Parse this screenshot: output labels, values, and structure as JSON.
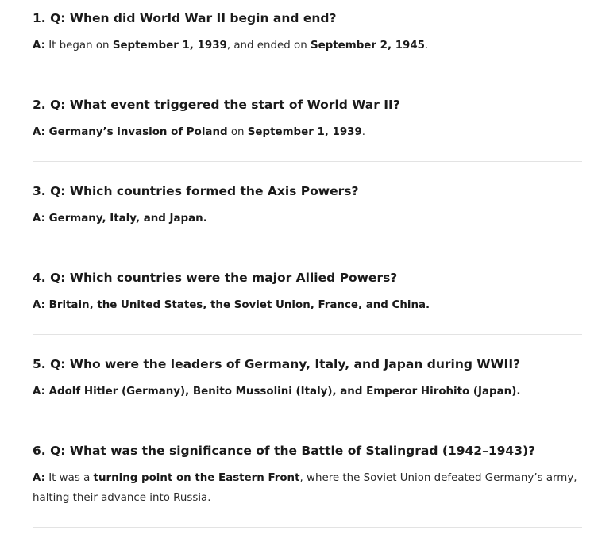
{
  "faq": [
    {
      "question": "1. Q: When did World War II begin and end?",
      "answer_label": "A:",
      "answer_parts": [
        {
          "text": " It began on ",
          "bold": false
        },
        {
          "text": "September 1, 1939",
          "bold": true
        },
        {
          "text": ", and ended on ",
          "bold": false
        },
        {
          "text": "September 2, 1945",
          "bold": true
        },
        {
          "text": ".",
          "bold": false
        }
      ]
    },
    {
      "question": "2. Q: What event triggered the start of World War II?",
      "answer_label": "A:",
      "answer_parts": [
        {
          "text": " Germany’s invasion of Poland",
          "bold": true
        },
        {
          "text": " on ",
          "bold": false
        },
        {
          "text": "September 1, 1939",
          "bold": true
        },
        {
          "text": ".",
          "bold": false
        }
      ]
    },
    {
      "question": "3. Q: Which countries formed the Axis Powers?",
      "answer_label": "A:",
      "answer_parts": [
        {
          "text": " Germany, Italy, and Japan.",
          "bold": true
        }
      ]
    },
    {
      "question": "4. Q: Which countries were the major Allied Powers?",
      "answer_label": "A:",
      "answer_parts": [
        {
          "text": " Britain, the United States, the Soviet Union, France, and China.",
          "bold": true
        }
      ]
    },
    {
      "question": "5. Q: Who were the leaders of Germany, Italy, and Japan during WWII?",
      "answer_label": "A:",
      "answer_parts": [
        {
          "text": " Adolf Hitler (Germany), Benito Mussolini (Italy), and Emperor Hirohito (Japan).",
          "bold": true
        }
      ]
    },
    {
      "question": "6. Q: What was the significance of the Battle of Stalingrad (1942–1943)?",
      "answer_label": "A:",
      "answer_parts": [
        {
          "text": " It was a ",
          "bold": false
        },
        {
          "text": "turning point on the Eastern Front",
          "bold": true
        },
        {
          "text": ", where the Soviet Union defeated Germany’s army, halting their advance into Russia.",
          "bold": false
        }
      ]
    }
  ]
}
